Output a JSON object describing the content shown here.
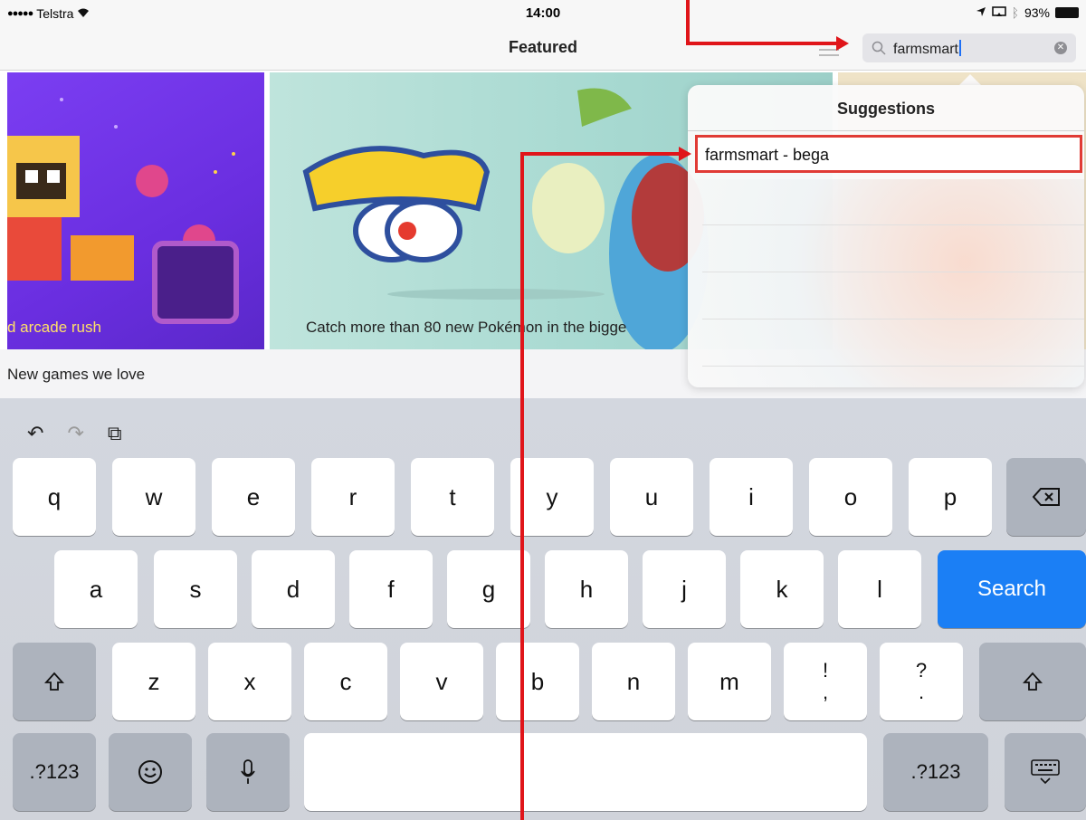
{
  "status_bar": {
    "carrier": "Telstra",
    "time": "14:00",
    "battery": "93%"
  },
  "navbar": {
    "title": "Featured",
    "search_value": "farmsmart"
  },
  "banners": [
    {
      "caption": "d arcade rush"
    },
    {
      "caption": "Catch more than 80 new Pokémon in the bigge"
    }
  ],
  "section": {
    "title": "New games we love"
  },
  "suggestions": {
    "title": "Suggestions",
    "items": [
      "farmsmart - bega"
    ]
  },
  "keyboard": {
    "row1": [
      "q",
      "w",
      "e",
      "r",
      "t",
      "y",
      "u",
      "i",
      "o",
      "p"
    ],
    "row2": [
      "a",
      "s",
      "d",
      "f",
      "g",
      "h",
      "j",
      "k",
      "l"
    ],
    "row3": [
      "z",
      "x",
      "c",
      "v",
      "b",
      "n",
      "m"
    ],
    "search_label": "Search",
    "numbers_label": ".?123",
    "punct_excl": [
      "!",
      ","
    ],
    "punct_quest": [
      "?",
      "."
    ]
  },
  "colors": {
    "accent": "#1b7ff5",
    "annotation": "#e0151a",
    "highlight_border": "#e03b35"
  }
}
